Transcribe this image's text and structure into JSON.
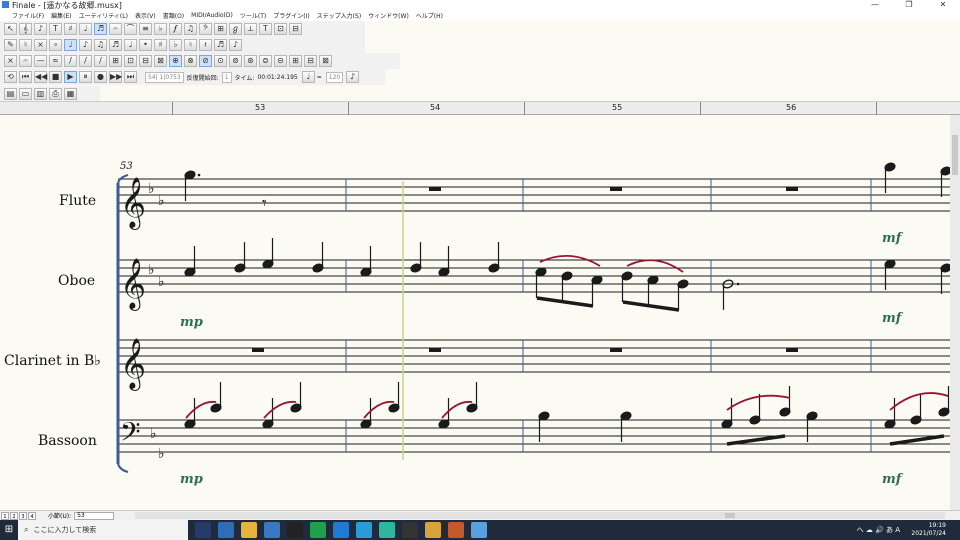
{
  "window": {
    "title": "Finale - [遥かなる故郷.musx]",
    "controls": [
      "—",
      "❐",
      "✕"
    ]
  },
  "menu": [
    "ファイル(F)",
    "編集(E)",
    "ユーティリティ(L)",
    "表示(V)",
    "書類(O)",
    "MIDI/Audio(D)",
    "ツール(T)",
    "プラグイン(I)",
    "ステップ入力(S)",
    "ウィンドウ(W)",
    "ヘルプ(H)"
  ],
  "toolbar1": [
    "↖",
    "𝄞",
    "♪",
    "T",
    "♯",
    "♩",
    "♬",
    "𝄐",
    "⌒",
    "≡",
    "♭",
    "𝆑",
    "♫",
    "𝄢",
    "⊞",
    "ℊ",
    "⟂",
    "T",
    "⊡",
    "⊟"
  ],
  "toolbar2": [
    "✎",
    "♮",
    "×",
    "∘",
    "♩",
    "♪",
    "♫",
    "♬",
    "♩",
    "•",
    "♯",
    "♭",
    "♮",
    "𝄽",
    "♬",
    "♪"
  ],
  "toolbar3": [
    "×",
    "𝄐",
    "—",
    "≈",
    "/",
    "/",
    "/",
    "⊞",
    "⊡",
    "⊟",
    "⊠",
    "⊕",
    "⊗",
    "⊘",
    "⊙",
    "⊚",
    "⊛",
    "⊜",
    "⊝",
    "⊞",
    "⊟",
    "⊠"
  ],
  "playback": {
    "buttons": [
      "⟲",
      "⏮",
      "◀◀",
      "■",
      "▶",
      "⏸",
      "●",
      "▶▶",
      "⏭"
    ],
    "position": "54| 1|0753",
    "start_label": "反復開始回:",
    "start_value": "1",
    "time_label": "タイム:",
    "time_value": "00:01:24.195",
    "tempo_note": "♩",
    "tempo_eq": "=",
    "tempo_value": "120"
  },
  "ruler": {
    "measures": [
      "53",
      "54",
      "55",
      "56"
    ]
  },
  "score": {
    "first_measure_number": "53",
    "instruments": [
      "Flute",
      "Oboe",
      "Clarinet in B♭",
      "Bassoon"
    ],
    "dynamics": {
      "oboe_mp": "mp",
      "bassoon_mp": "mp",
      "flute_mf": "mf",
      "oboe_mf": "mf",
      "bassoon_mf": "mf"
    },
    "colors": {
      "staff": "#1a1a1a",
      "barline_blue": "#3c5a9a",
      "slur": "#9a1530",
      "dynamic": "#2e6e55",
      "cursor": "#c8d888"
    }
  },
  "status": {
    "pages": [
      "1",
      "2",
      "3",
      "4"
    ],
    "measure_label": "小節(U):",
    "measure_value": "53"
  },
  "taskbar": {
    "search_placeholder": "ここに入力して検索",
    "tray_text": "へ ☁ 🔊 あ A",
    "time": "19:19",
    "date": "2021/07/24"
  }
}
